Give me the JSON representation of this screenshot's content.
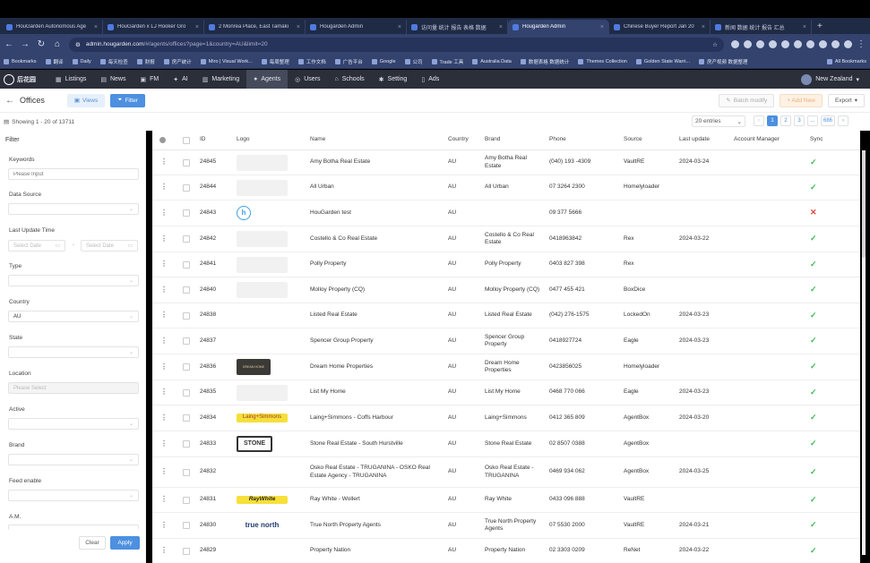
{
  "browser": {
    "tabs": [
      {
        "title": "HouGarden Autonomous Age",
        "active": false
      },
      {
        "title": "HouGarden x LJ Hooker Gro",
        "active": false
      },
      {
        "title": "2 Monrea Place, East Tamaki",
        "active": false
      },
      {
        "title": "Hougarden Admin",
        "active": false
      },
      {
        "title": "访问量 统计 报告 表格 数据",
        "active": false
      },
      {
        "title": "Hougarden Admin",
        "active": true
      },
      {
        "title": "Chinese Buyer Report Jan 20",
        "active": false
      },
      {
        "title": "新闻 数据 统计 报告 汇总",
        "active": false
      }
    ],
    "new_tab": "+",
    "url_host": "admin.hougarden.com",
    "url_path": "/#/agents/offices?page=1&country=AU&limit=20",
    "bookmarks": [
      "Bookmarks",
      "翻译",
      "Daily",
      "每天检查",
      "财报",
      "房产统计",
      "Miro | Visual Work...",
      "每周整理",
      "工作文档",
      "广告平台",
      "Google",
      "公司",
      "Trade 工具",
      "Australia Data",
      "数据表格 数据统计",
      "Themes Collection",
      "Golden State Warri...",
      "房产视频 数据整理"
    ],
    "all_bookmarks": "All Bookmarks"
  },
  "app": {
    "brand_name": "后花园",
    "nav": [
      {
        "label": "Listings",
        "icon": "listings-icon",
        "glyph": "▦",
        "active": false
      },
      {
        "label": "News",
        "icon": "news-icon",
        "glyph": "▤",
        "active": false
      },
      {
        "label": "FM",
        "icon": "fm-icon",
        "glyph": "▣",
        "active": false
      },
      {
        "label": "AI",
        "icon": "ai-icon",
        "glyph": "✦",
        "active": false
      },
      {
        "label": "Marketing",
        "icon": "marketing-icon",
        "glyph": "▥",
        "active": false
      },
      {
        "label": "Agents",
        "icon": "agents-icon",
        "glyph": "●",
        "active": true
      },
      {
        "label": "Users",
        "icon": "users-icon",
        "glyph": "◎",
        "active": false
      },
      {
        "label": "Schools",
        "icon": "schools-icon",
        "glyph": "⌂",
        "active": false
      },
      {
        "label": "Setting",
        "icon": "setting-icon",
        "glyph": "✱",
        "active": false
      },
      {
        "label": "Ads",
        "icon": "ads-icon",
        "glyph": "▯",
        "active": false
      }
    ],
    "region": "New Zealand"
  },
  "toolbar": {
    "title": "Offices",
    "views_label": "Views",
    "filter_label": "Filter",
    "batch_modify_label": "Batch modify",
    "add_new_label": "+ Add New",
    "export_label": "Export"
  },
  "info": {
    "showing": "Showing 1 - 20 of 13711",
    "entries": "20 entries",
    "pages": [
      "1",
      "2",
      "3",
      "...",
      "686"
    ]
  },
  "filter": {
    "title": "Filter",
    "keywords_label": "Keywords",
    "keywords_placeholder": "Please Input",
    "data_source_label": "Data Source",
    "data_source_value": "",
    "last_update_label": "Last Update Time",
    "date_start_placeholder": "Select Date",
    "date_end_placeholder": "Select Date",
    "date_sep": "-",
    "type_label": "Type",
    "country_label": "Country",
    "country_value": "AU",
    "state_label": "State",
    "location_label": "Location",
    "location_placeholder": "Please Select",
    "active_label": "Active",
    "brand_label": "Brand",
    "feed_enable_label": "Feed enable",
    "am_label": "A.M.",
    "clear_label": "Clear",
    "apply_label": "Apply"
  },
  "table": {
    "headers": {
      "id": "ID",
      "logo": "Logo",
      "name": "Name",
      "country": "Country",
      "brand": "Brand",
      "phone": "Phone",
      "source": "Source",
      "last_update": "Last update",
      "account_manager": "Account Manager",
      "sync": "Sync"
    },
    "rows": [
      {
        "id": "24845",
        "logo": "blank",
        "name": "Amy Botha Real Estate",
        "country": "AU",
        "brand": "Amy Botha Real Estate",
        "phone": "(040) 193 -4309",
        "source": "VaultRE",
        "last_update": "2024-03-24",
        "am": "",
        "sync": "ok"
      },
      {
        "id": "24844",
        "logo": "blank",
        "name": "All Urban",
        "country": "AU",
        "brand": "All Urban",
        "phone": "07 3264 2300",
        "source": "Homelyloader",
        "last_update": "",
        "am": "",
        "sync": "ok"
      },
      {
        "id": "24843",
        "logo": "h",
        "name": "HouGarden test",
        "country": "AU",
        "brand": "",
        "phone": "09 377 5666",
        "source": "",
        "last_update": "",
        "am": "",
        "sync": "fail"
      },
      {
        "id": "24842",
        "logo": "blank",
        "name": "Costello & Co Real Estate",
        "country": "AU",
        "brand": "Costello & Co Real Estate",
        "phone": "0418963842",
        "source": "Rex",
        "last_update": "2024-03-22",
        "am": "",
        "sync": "ok"
      },
      {
        "id": "24841",
        "logo": "blank",
        "name": "Polly Property",
        "country": "AU",
        "brand": "Polly Property",
        "phone": "0403 827 398",
        "source": "Rex",
        "last_update": "",
        "am": "",
        "sync": "ok"
      },
      {
        "id": "24840",
        "logo": "blank",
        "name": "Molloy Property (CQ)",
        "country": "AU",
        "brand": "Molloy Property (CQ)",
        "phone": "0477 455 421",
        "source": "BoxDice",
        "last_update": "",
        "am": "",
        "sync": "ok"
      },
      {
        "id": "24838",
        "logo": "none",
        "name": "Listed Real Estate",
        "country": "AU",
        "brand": "Listed Real Estate",
        "phone": "(042) 276-1575",
        "source": "LockedOn",
        "last_update": "2024-03-23",
        "am": "",
        "sync": "ok"
      },
      {
        "id": "24837",
        "logo": "none",
        "name": "Spencer Group Property",
        "country": "AU",
        "brand": "Spencer Group Property",
        "phone": "0418927724",
        "source": "Eagle",
        "last_update": "2024-03-23",
        "am": "",
        "sync": "ok"
      },
      {
        "id": "24836",
        "logo": "dream",
        "name": "Dream Home Properties",
        "country": "AU",
        "brand": "Dream Home Properties",
        "phone": "0423856025",
        "source": "Homelyloader",
        "last_update": "",
        "am": "",
        "sync": "ok"
      },
      {
        "id": "24835",
        "logo": "blank",
        "name": "List My Home",
        "country": "AU",
        "brand": "List My Home",
        "phone": "0468 770 066",
        "source": "Eagle",
        "last_update": "2024-03-23",
        "am": "",
        "sync": "ok"
      },
      {
        "id": "24834",
        "logo": "laing",
        "name": "Laing+Simmons - Coffs Harbour",
        "country": "AU",
        "brand": "Laing+Simmons",
        "phone": "0412 365 809",
        "source": "AgentBox",
        "last_update": "2024-03-20",
        "am": "",
        "sync": "ok"
      },
      {
        "id": "24833",
        "logo": "stone",
        "name": "Stone Real Estate - South Hurstville",
        "country": "AU",
        "brand": "Stone Real Estate",
        "phone": "02 8507 0388",
        "source": "AgentBox",
        "last_update": "",
        "am": "",
        "sync": "ok"
      },
      {
        "id": "24832",
        "logo": "osko",
        "name": "Osko Real Estate - TRUGANINA - OSKO Real Estate Agency - TRUGANINA",
        "country": "AU",
        "brand": "Osko Real Estate - TRUGANINA",
        "phone": "0469 934 062",
        "source": "AgentBox",
        "last_update": "2024-03-25",
        "am": "",
        "sync": "ok"
      },
      {
        "id": "24831",
        "logo": "raywhite",
        "name": "Ray White - Wollert",
        "country": "AU",
        "brand": "Ray White",
        "phone": "0433 096 888",
        "source": "VaultRE",
        "last_update": "",
        "am": "",
        "sync": "ok"
      },
      {
        "id": "24830",
        "logo": "truenorth",
        "name": "True North Property Agents",
        "country": "AU",
        "brand": "True North Property Agents",
        "phone": "07 5530 2000",
        "source": "VaultRE",
        "last_update": "2024-03-21",
        "am": "",
        "sync": "ok"
      },
      {
        "id": "24829",
        "logo": "none",
        "name": "Property Nation",
        "country": "AU",
        "brand": "Property Nation",
        "phone": "02 3303 0209",
        "source": "ReNet",
        "last_update": "2024-03-22",
        "am": "",
        "sync": "ok"
      }
    ],
    "logo_text": {
      "h": "h",
      "dream": "DREAM HOME",
      "laing": "Laing+Simmons",
      "stone": "STONE",
      "raywhite": "RayWhite",
      "truenorth": "true north"
    }
  },
  "colors": {
    "accent": "#4d90e0",
    "nav_bg": "#2b2f3a",
    "tab_bg": "#1f2a45",
    "sync_ok": "#3cba55",
    "sync_fail": "#e0443a"
  }
}
